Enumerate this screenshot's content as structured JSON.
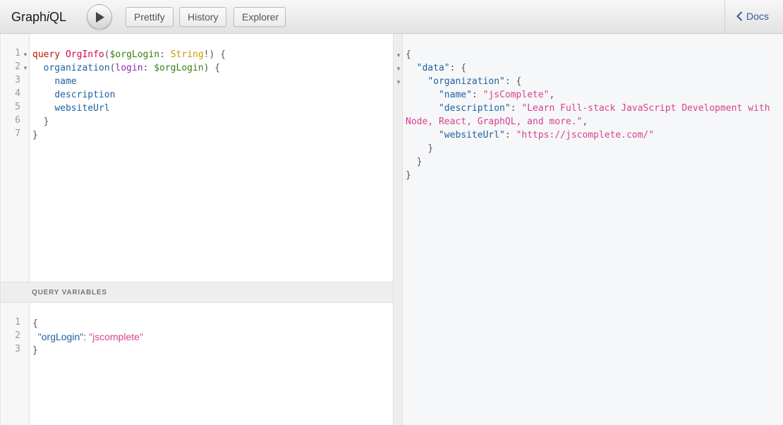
{
  "toolbar": {
    "title_prefix": "Graph",
    "title_italic": "i",
    "title_suffix": "QL",
    "run_icon": "play-icon",
    "prettify_label": "Prettify",
    "history_label": "History",
    "explorer_label": "Explorer",
    "docs_label": "Docs",
    "docs_icon": "chevron-left-icon"
  },
  "query_editor": {
    "line_numbers": [
      "1",
      "2",
      "3",
      "4",
      "5",
      "6",
      "7"
    ],
    "tokens": {
      "l1_kw": "query",
      "l1_def": "OrgInfo",
      "l1_p1": "(",
      "l1_var": "$orgLogin",
      "l1_p2": ": ",
      "l1_type": "String",
      "l1_p3": "!) {",
      "l2_prop": "organization",
      "l2_p1": "(",
      "l2_attr": "login",
      "l2_p2": ": ",
      "l2_var": "$orgLogin",
      "l2_p3": ") {",
      "l3": "name",
      "l4": "description",
      "l5": "websiteUrl",
      "l6": "}",
      "l7": "}"
    }
  },
  "variables": {
    "header": "QUERY VARIABLES",
    "line_numbers": [
      "1",
      "2",
      "3"
    ],
    "l1": "{",
    "key": "\"orgLogin\"",
    "colon": ": ",
    "value": "\"jscomplete\"",
    "l3": "}"
  },
  "result": {
    "open": "{",
    "data_key": "\"data\"",
    "org_key": "\"organization\"",
    "name_key": "\"name\"",
    "name_value": "\"jsComplete\"",
    "desc_key": "\"description\"",
    "desc_value_1": "\"Learn Full-stack JavaScript Development with",
    "desc_value_2": "Node, React, GraphQL, and more.\"",
    "url_key": "\"websiteUrl\"",
    "url_value": "\"https://jscomplete.com/\"",
    "colon_brace": ": {",
    "colon": ": ",
    "comma": ",",
    "close": "}"
  },
  "colors": {
    "keyword": "#B11A04",
    "definition": "#D2054E",
    "variable": "#397D13",
    "type": "#CA9800",
    "property": "#1F61A0",
    "attribute": "#8B2BB9",
    "string": "#D64292",
    "docs_link": "#3b5998"
  }
}
